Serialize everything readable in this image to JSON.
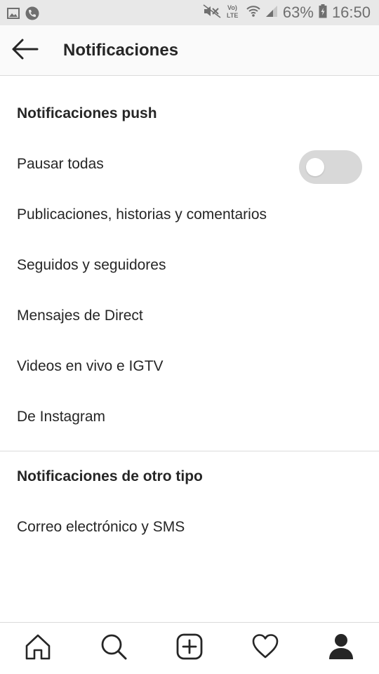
{
  "status_bar": {
    "battery_percent": "63%",
    "time": "16:50",
    "network": "Vo) LTE",
    "icons": [
      "gallery-icon",
      "phone-icon",
      "mute-icon",
      "volte-icon",
      "wifi-icon",
      "signal-icon",
      "battery-icon"
    ]
  },
  "header": {
    "title": "Notificaciones",
    "back_icon": "arrow-left-icon"
  },
  "push_section": {
    "title": "Notificaciones push",
    "pause_all": {
      "label": "Pausar todas",
      "enabled": false
    },
    "items": [
      {
        "label": "Publicaciones, historias y comentarios"
      },
      {
        "label": "Seguidos y seguidores"
      },
      {
        "label": "Mensajes de Direct"
      },
      {
        "label": "Videos en vivo e IGTV"
      },
      {
        "label": "De Instagram"
      }
    ]
  },
  "other_section": {
    "title": "Notificaciones de otro tipo",
    "items": [
      {
        "label": "Correo electrónico y SMS"
      }
    ]
  },
  "bottom_nav": {
    "items": [
      "home-icon",
      "search-icon",
      "add-post-icon",
      "activity-heart-icon",
      "profile-icon"
    ],
    "active": "profile-icon"
  },
  "colors": {
    "text": "#262626",
    "divider": "#dbdbdb",
    "toggle_off": "#d8d8d8",
    "status_bar_bg": "#e8e8e8",
    "header_bg": "#fafafa"
  }
}
